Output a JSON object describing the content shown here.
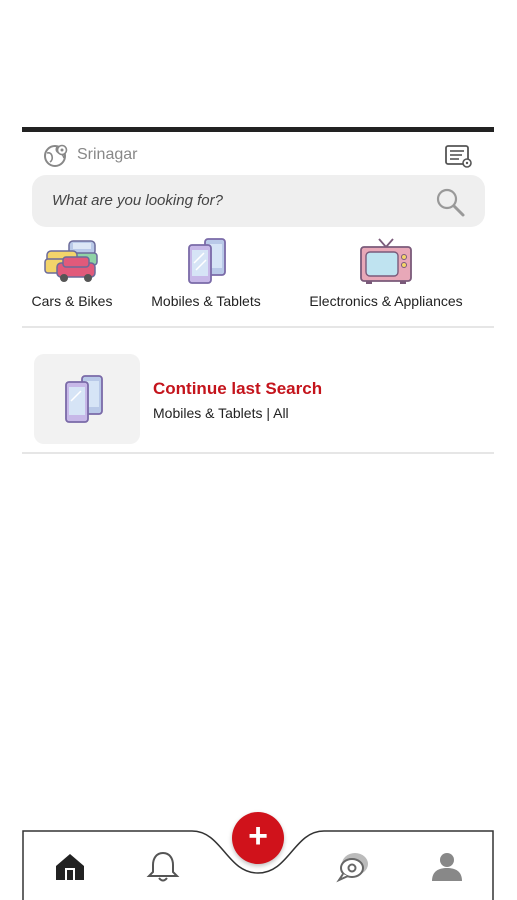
{
  "location": {
    "name": "Srinagar"
  },
  "search": {
    "placeholder": "What are you looking for?"
  },
  "categories": [
    {
      "label": "Cars & Bikes",
      "icon": "cars-icon"
    },
    {
      "label": "Mobiles & Tablets",
      "icon": "mobiles-icon"
    },
    {
      "label": "Electronics & Appliances",
      "icon": "tv-icon"
    }
  ],
  "last_search": {
    "title": "Continue last Search",
    "subtitle": "Mobiles & Tablets | All"
  },
  "bottom_nav": {
    "items": [
      "home-icon",
      "bell-icon",
      "chat-icon",
      "profile-icon"
    ],
    "fab_label": "+"
  },
  "colors": {
    "accent": "#d0121b",
    "title_red": "#c4141c",
    "search_bg": "#efefef"
  }
}
